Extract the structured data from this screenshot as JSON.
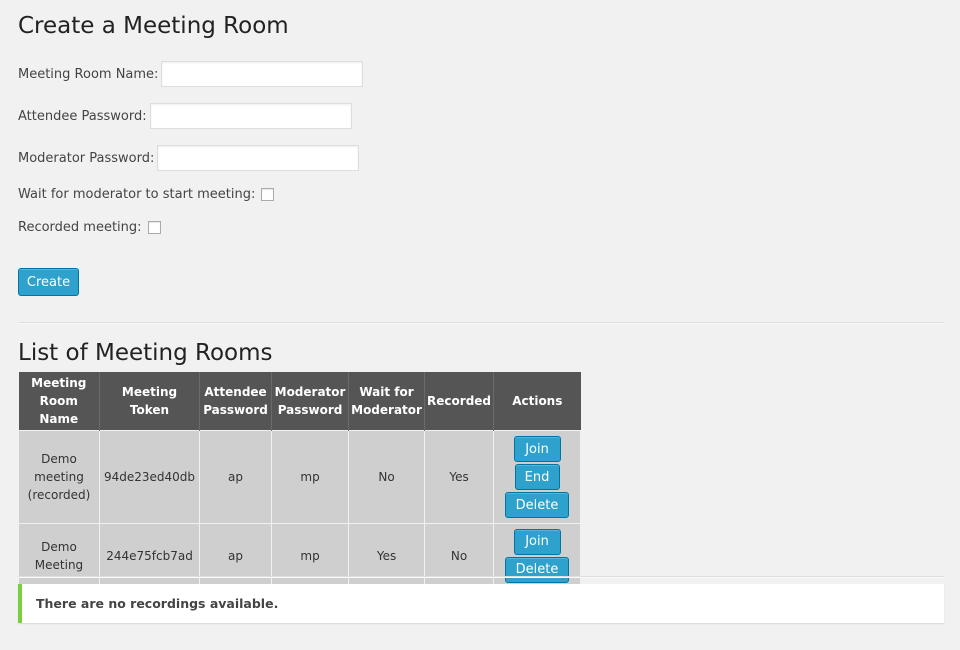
{
  "create_section": {
    "title": "Create a Meeting Room",
    "name_label": "Meeting Room Name:",
    "name_value": "",
    "attendee_label": "Attendee Password:",
    "attendee_value": "",
    "moderator_label": "Moderator Password:",
    "moderator_value": "",
    "wait_label": "Wait for moderator to start meeting:",
    "wait_checked": false,
    "recorded_label": "Recorded meeting:",
    "recorded_checked": false,
    "create_button": "Create"
  },
  "list_section": {
    "title": "List of Meeting Rooms",
    "columns": [
      "Meeting Room Name",
      "Meeting Token",
      "Attendee Password",
      "Moderator Password",
      "Wait for Moderator",
      "Recorded",
      "Actions"
    ],
    "rows": [
      {
        "name": "Demo meeting (recorded)",
        "token": "94de23ed40db",
        "attendee": "ap",
        "moderator": "mp",
        "wait": "No",
        "recorded": "Yes",
        "actions": [
          "Join",
          "End",
          "Delete"
        ]
      },
      {
        "name": "Demo Meeting",
        "token": "244e75fcb7ad",
        "attendee": "ap",
        "moderator": "mp",
        "wait": "Yes",
        "recorded": "No",
        "actions": [
          "Join",
          "Delete"
        ]
      }
    ]
  },
  "notice": {
    "text": "There are no recordings available.",
    "accent_color": "#7ad03a"
  },
  "colors": {
    "button": "#2ea2cc",
    "table_header": "#555555",
    "table_cell": "#cfcfcf"
  }
}
